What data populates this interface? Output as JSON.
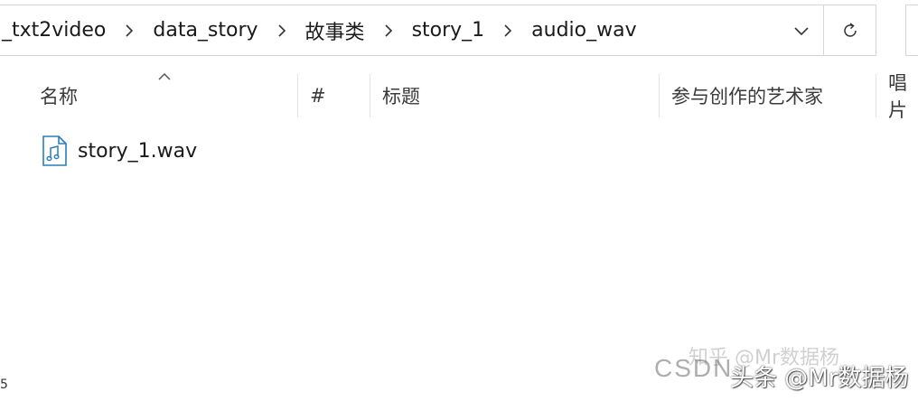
{
  "address_bar": {
    "crumbs": [
      "_txt2video",
      "data_story",
      "故事类",
      "story_1",
      "audio_wav"
    ]
  },
  "columns": {
    "name": "名称",
    "number": "#",
    "title": "标题",
    "artists": "参与创作的艺术家",
    "singer": "唱片"
  },
  "files": [
    {
      "name": "story_1.wav",
      "icon": "audio-file-icon"
    }
  ],
  "watermarks": {
    "zhihu": "知乎 @Mr数据杨",
    "csdn": "CSDN",
    "toutiao": "头条 @Mr数据杨"
  },
  "edge_text": "5"
}
